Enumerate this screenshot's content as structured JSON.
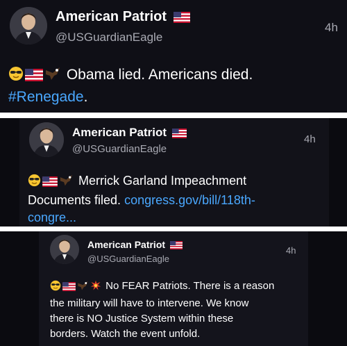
{
  "posts": [
    {
      "display_name": "American Patriot",
      "handle": "@USGuardianEagle",
      "time": "4h",
      "text": "Obama lied. Americans died.",
      "hashtag": "#Renegade",
      "trailing": "."
    },
    {
      "display_name": "American Patriot",
      "handle": "@USGuardianEagle",
      "time": "4h",
      "text_line1": "Merrick Garland Impeachment",
      "text_line2_plain": "Documents filed.",
      "link_part1": "congress.gov/bill/118th-",
      "link_part2": "congre..."
    },
    {
      "display_name": "American Patriot",
      "handle": "@USGuardianEagle",
      "time": "4h",
      "line1": "No FEAR Patriots. There is a reason",
      "line2": "the military will have to intervene. We know",
      "line3": "there is NO Justice System within these",
      "line4": "borders. Watch the event unfold."
    }
  ],
  "icons": [
    "sunglasses-emoji",
    "us-flag",
    "eagle-emoji",
    "collision-emoji"
  ],
  "colors": {
    "link": "#4aa8ff",
    "muted": "#a9aab3",
    "background": "#0f0f16"
  }
}
